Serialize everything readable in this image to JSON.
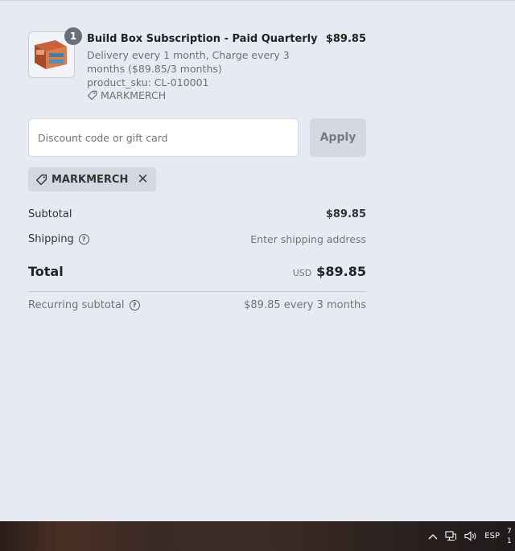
{
  "product": {
    "quantity": "1",
    "title": "Build Box Subscription - Paid Quarterly",
    "price": "$89.85",
    "subtitle": "Delivery every 1 month, Charge every 3 months ($89.85/3 months)",
    "sku": "product_sku: CL-010001",
    "discount_tag": "MARKMERCH"
  },
  "discount": {
    "placeholder": "Discount code or gift card",
    "apply_label": "Apply",
    "applied_code": "MARKMERCH"
  },
  "totals": {
    "subtotal_label": "Subtotal",
    "subtotal_value": "$89.85",
    "shipping_label": "Shipping",
    "shipping_value": "Enter shipping address",
    "total_label": "Total",
    "currency": "USD",
    "total_value": "$89.85",
    "recurring_label": "Recurring subtotal",
    "recurring_value": "$89.85 every 3 months"
  },
  "taskbar": {
    "language": "ESP",
    "clock_time": "7",
    "clock_date": "1"
  },
  "icons": [
    "tag-icon",
    "remove-icon",
    "help-icon",
    "chevron-up-icon",
    "network-icon",
    "volume-icon"
  ]
}
